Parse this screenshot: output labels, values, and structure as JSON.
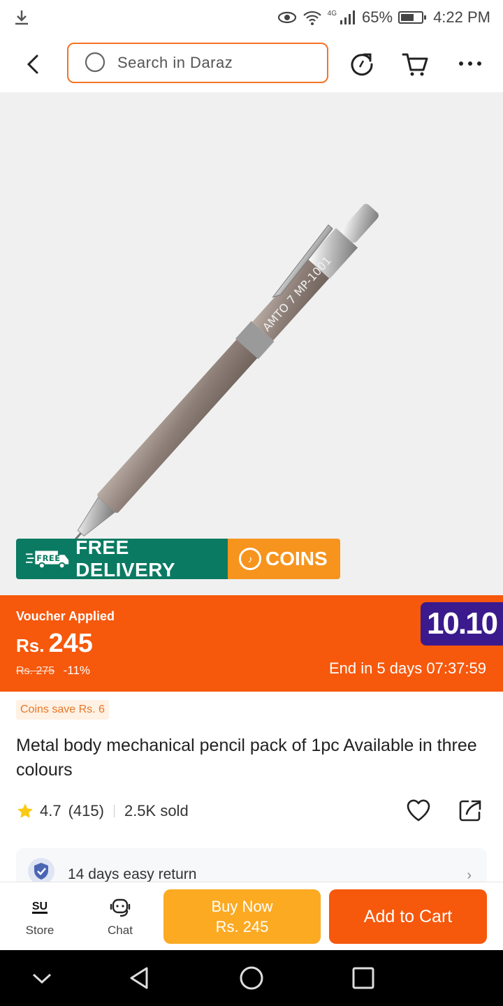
{
  "status_bar": {
    "time": "4:22 PM",
    "battery": "65%",
    "network": "4G",
    "battery_level": 0.65
  },
  "header": {
    "search_placeholder": "Search in Daraz"
  },
  "product_badge": {
    "free_delivery": "FREE DELIVERY",
    "free_tag": "FREE",
    "coins": "COINS",
    "brand_print": "AMTO 7 MP-1001"
  },
  "price_banner": {
    "voucher": "Voucher Applied",
    "currency": "Rs.",
    "price": "245",
    "original_price": "Rs. 275",
    "discount": "-11%",
    "campaign_badge": "10.10",
    "countdown": "End in 5 days 07:37:59"
  },
  "coins_save": "Coins save Rs. 6",
  "product": {
    "title": "Metal body mechanical pencil pack of 1pc Available in three colours",
    "rating": "4.7",
    "reviews": "(415)",
    "sold": "2.5K sold"
  },
  "service": {
    "return_policy": "14 days easy return"
  },
  "action_bar": {
    "store_logo": "SU",
    "store": "Store",
    "chat": "Chat",
    "buy_now": "Buy Now",
    "buy_now_price": "Rs. 245",
    "add_to_cart": "Add to Cart"
  },
  "colors": {
    "brand_orange": "#f6580c",
    "free_delivery_green": "#0b7a62",
    "coins_yellow": "#f7941d",
    "buy_now_yellow": "#fcaa22",
    "campaign_purple": "#3a1a8c"
  }
}
